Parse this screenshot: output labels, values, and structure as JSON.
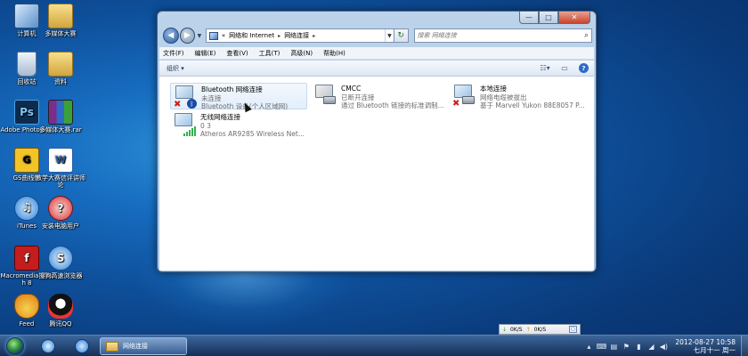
{
  "desktop": {
    "icons": [
      {
        "name": "computer",
        "label": "计算机"
      },
      {
        "name": "multimedia-folder",
        "label": "多媒体大赛"
      },
      {
        "name": "recycle-bin",
        "label": "回收站"
      },
      {
        "name": "materials-folder",
        "label": "资料"
      },
      {
        "name": "photoshop",
        "label": "Adobe Photosh..."
      },
      {
        "name": "rar-archive",
        "label": "多媒体大赛.rar"
      },
      {
        "name": "geogebra",
        "label": "GS曲线性"
      },
      {
        "name": "teaching-doc",
        "label": "教学大赛信评讲师论"
      },
      {
        "name": "itunes",
        "label": "iTunes"
      },
      {
        "name": "install-app",
        "label": "安装电脑用户"
      },
      {
        "name": "flash",
        "label": "Macromedia Flash 8"
      },
      {
        "name": "sogou-browser",
        "label": "搜狗高速浏览器"
      },
      {
        "name": "feed",
        "label": "Feed"
      },
      {
        "name": "qq",
        "label": "腾讯QQ"
      }
    ]
  },
  "window": {
    "controls": {
      "minimize": "—",
      "maximize": "□",
      "close": "✕"
    },
    "address": {
      "prefix": "«",
      "crumbs": [
        "网络和 Internet",
        "网络连接"
      ],
      "sep": "▸"
    },
    "search": {
      "placeholder": "搜索 网络连接"
    },
    "menu": [
      "文件(F)",
      "编辑(E)",
      "查看(V)",
      "工具(T)",
      "高级(N)",
      "帮助(H)"
    ],
    "toolbar": {
      "organize": "组织 ▾",
      "help": "?"
    },
    "connections": [
      {
        "name": "Bluetooth 网络连接",
        "status": "未连接",
        "device": "Bluetooth 设备(个人区域网)",
        "badge": "bluetooth",
        "disabled": true,
        "selected": true
      },
      {
        "name": "CMCC",
        "status": "已断开连接",
        "device": "通过 Bluetooth 链接的标准调制...",
        "badge": "none",
        "disabled": false,
        "selected": false
      },
      {
        "name": "本地连接",
        "status": "网络电缆被拔出",
        "device": "基于 Marvell Yukon 88E8057 P...",
        "badge": "none",
        "disabled": true,
        "selected": false
      },
      {
        "name": "无线网络连接",
        "status": "0 3",
        "device": "Atheros AR9285 Wireless Net...",
        "badge": "signal",
        "disabled": false,
        "selected": false
      }
    ]
  },
  "netmon": {
    "down": "0K/S",
    "up": "0K/S"
  },
  "taskbar": {
    "task_label": "网络连接",
    "clock_time": "10:58",
    "clock_date": "2012-08-27",
    "clock_day": "七月十一 周一"
  },
  "colors": {
    "accent": "#2d6bc5",
    "error": "#d21d1d",
    "signal": "#2db44a"
  }
}
